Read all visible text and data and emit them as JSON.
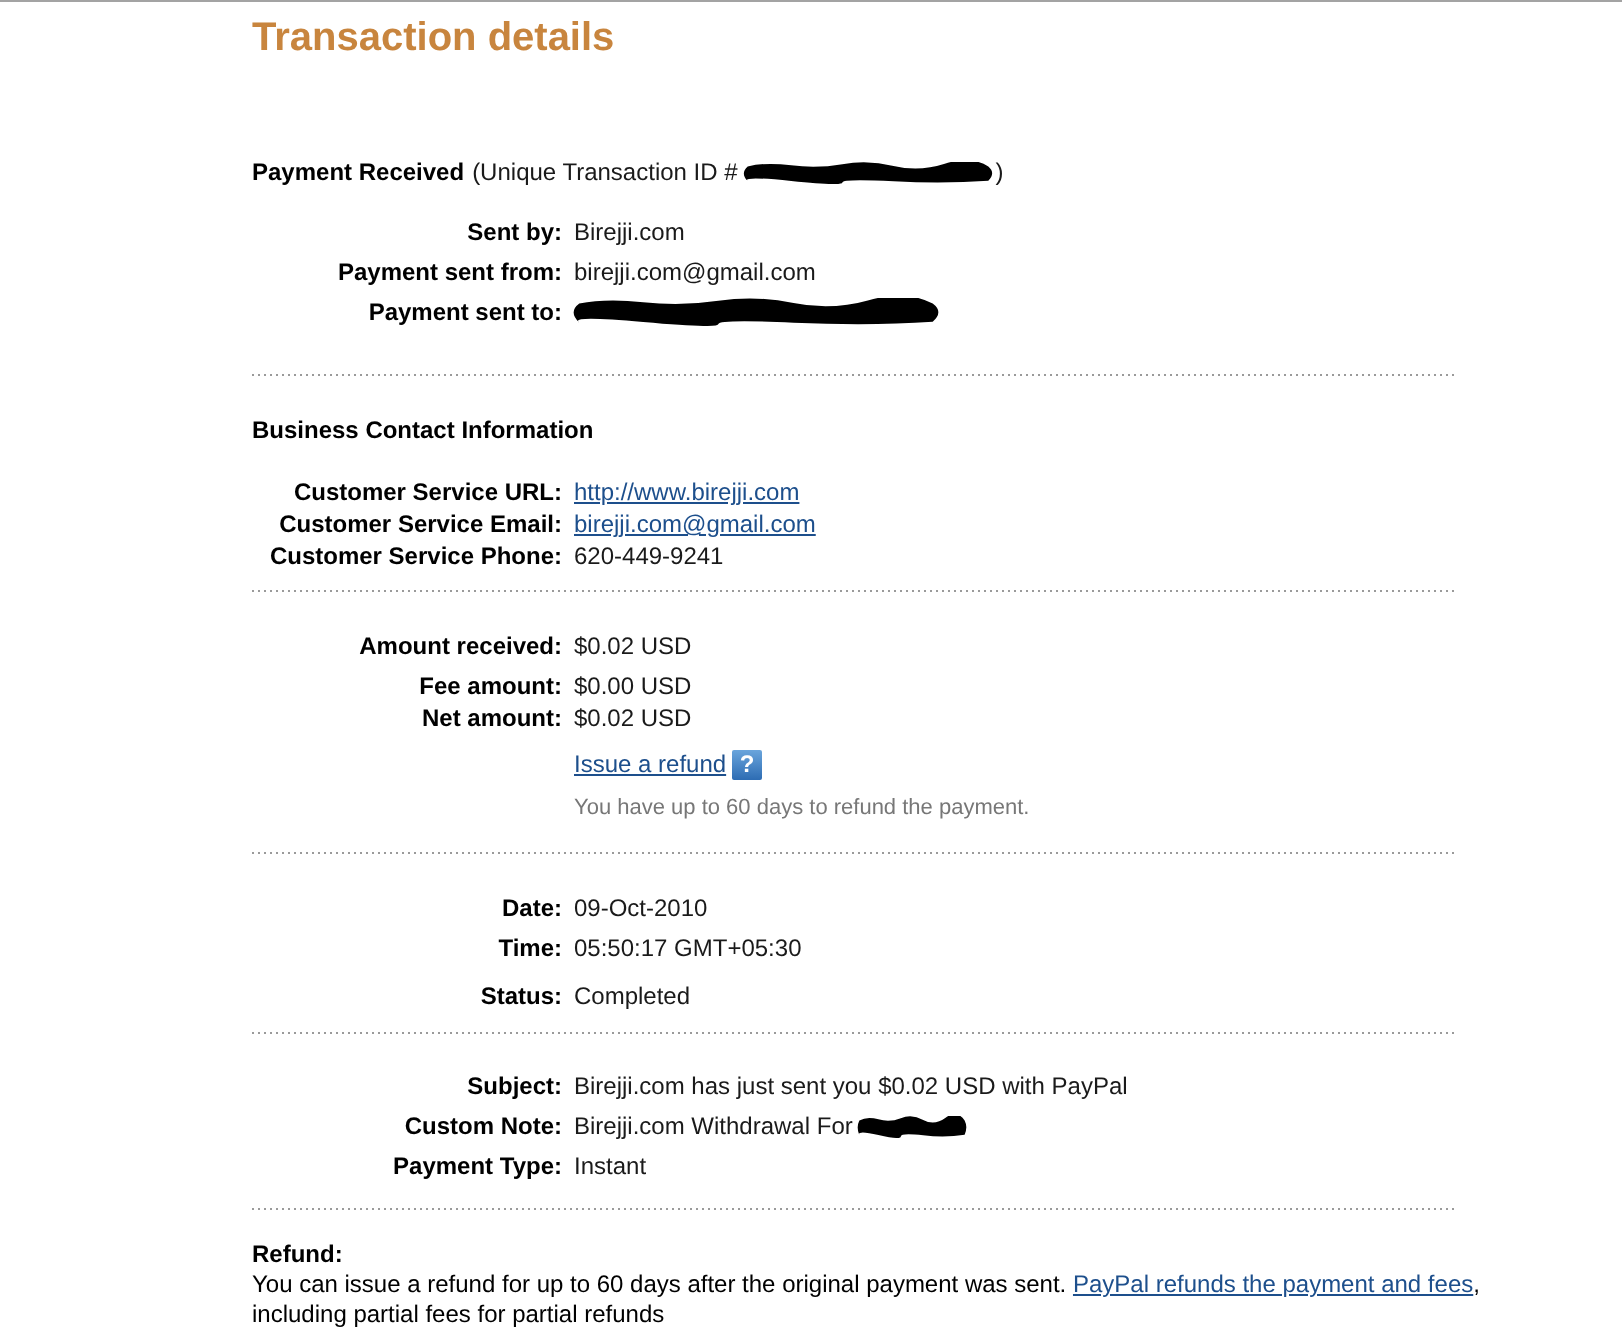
{
  "title": "Transaction details",
  "payment_header": {
    "heading": "Payment Received",
    "id_prefix": "(Unique Transaction ID #",
    "id_redacted": true,
    "id_suffix": ")"
  },
  "sender_rows": [
    {
      "label": "Sent by:",
      "value": "Birejji.com",
      "kind": "text",
      "redacted": false
    },
    {
      "label": "Payment sent from:",
      "value": "birejji.com@gmail.com",
      "kind": "text",
      "redacted": false
    },
    {
      "label": "Payment sent to:",
      "kind": "text",
      "redacted": true
    }
  ],
  "business_contact": {
    "heading": "Business Contact Information",
    "rows": [
      {
        "label": "Customer Service URL:",
        "value": "http://www.birejji.com",
        "kind": "link"
      },
      {
        "label": "Customer Service Email:",
        "value": "birejji.com@gmail.com",
        "kind": "link"
      },
      {
        "label": "Customer Service Phone:",
        "value": "620-449-9241",
        "kind": "text"
      }
    ]
  },
  "amount_rows": [
    {
      "label": "Amount received:",
      "value": "$0.02 USD",
      "kind": "text"
    },
    {
      "label": "Fee amount:",
      "value": "$0.00 USD",
      "kind": "text"
    },
    {
      "label": "Net amount:",
      "value": "$0.02 USD",
      "kind": "text"
    }
  ],
  "refund_action": {
    "link": "Issue a refund",
    "help_icon": "?",
    "note": "You have up to 60 days to refund the payment."
  },
  "status_rows": [
    {
      "label": "Date:",
      "value": "09-Oct-2010",
      "kind": "text"
    },
    {
      "label": "Time:",
      "value": "05:50:17 GMT+05:30",
      "kind": "text"
    },
    {
      "label": "Status:",
      "value": "Completed",
      "kind": "text"
    }
  ],
  "message_rows": [
    {
      "label": "Subject:",
      "value": "Birejji.com has just sent you $0.02 USD with PayPal",
      "kind": "text",
      "redacted": false
    },
    {
      "label": "Custom Note:",
      "value": "Birejji.com Withdrawal For",
      "kind": "text",
      "redacted": true
    },
    {
      "label": "Payment Type:",
      "value": "Instant",
      "kind": "text",
      "redacted": false
    }
  ],
  "refund_info": {
    "heading": "Refund:",
    "text": "You can issue a refund for up to 60 days after the original payment was sent.",
    "link": "PayPal refunds the payment and fees",
    "tail": ", including partial fees for partial refunds"
  }
}
